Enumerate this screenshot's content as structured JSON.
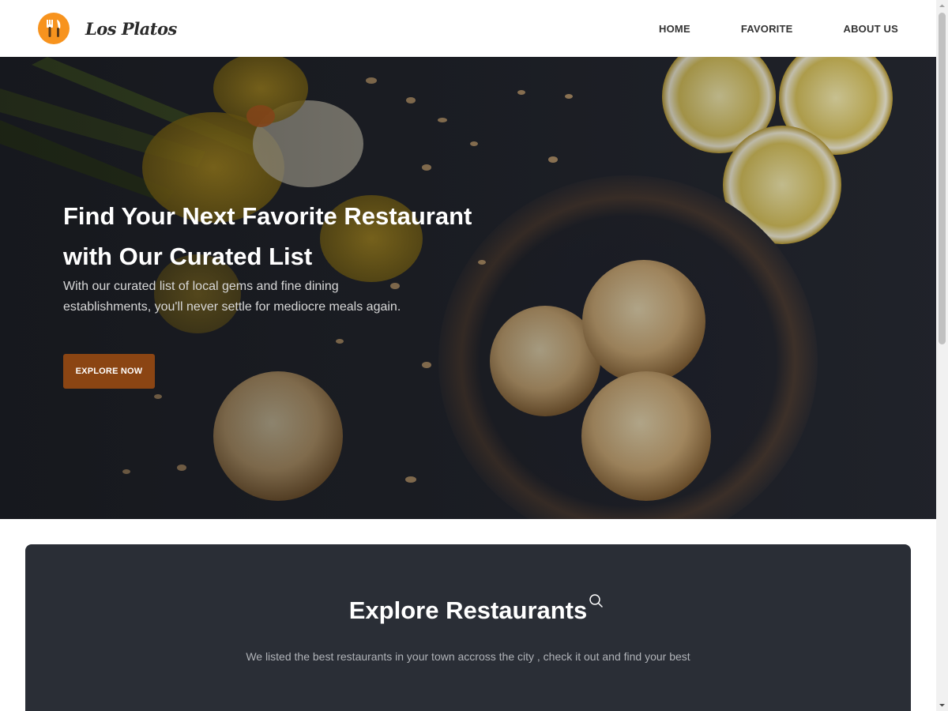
{
  "header": {
    "brand_name": "Los Platos",
    "logo_icon": "fork-knife-icon",
    "nav": [
      {
        "label": "HOME"
      },
      {
        "label": "FAVORITE"
      },
      {
        "label": "ABOUT US"
      }
    ]
  },
  "hero": {
    "title": "Find Your Next Favorite Restaurant with Our Curated List",
    "subtitle": "With our curated list of local gems and fine dining establishments, you'll never settle for mediocre meals again.",
    "button_label": "EXPLORE NOW",
    "button_color": "#8b4513"
  },
  "explore": {
    "title": "Explore Restaurants",
    "subtitle": "We listed the best restaurants in your town accross the city , check it out and find your best",
    "search_icon": "search-icon",
    "background_color": "#2a2e36"
  },
  "colors": {
    "accent": "#f7931e",
    "button": "#8b4513",
    "panel": "#2a2e36"
  }
}
